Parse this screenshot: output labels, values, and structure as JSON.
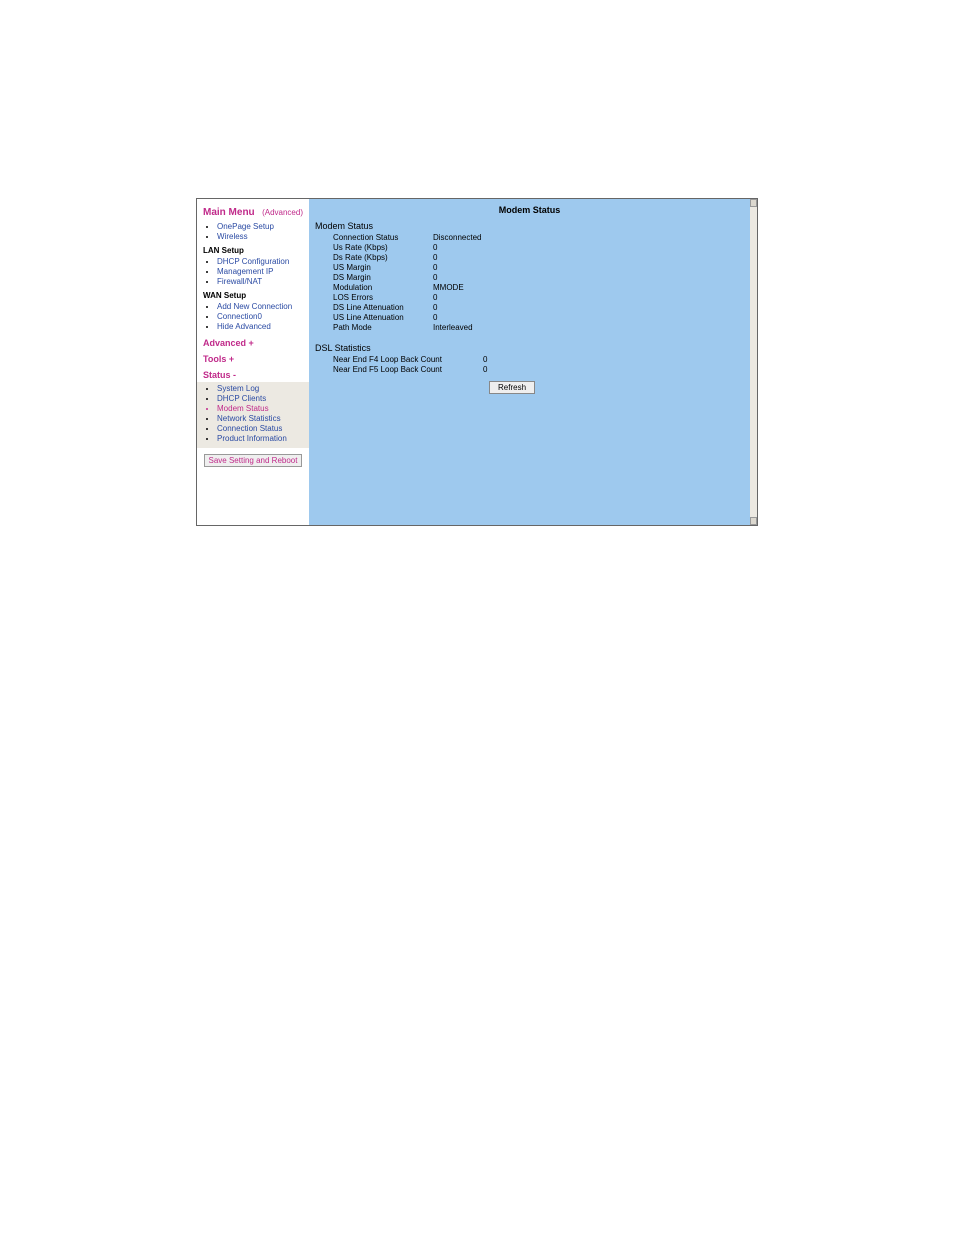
{
  "sidebar": {
    "main_menu_label": "Main Menu",
    "advanced_label": "(Advanced)",
    "nav": {
      "onepage": "OnePage Setup",
      "wireless": "Wireless",
      "lan_heading": "LAN Setup",
      "dhcp_config": "DHCP Configuration",
      "mgmt_ip": "Management IP",
      "firewall": "Firewall/NAT",
      "wan_heading": "WAN Setup",
      "add_conn": "Add New Connection",
      "conn0": "Connection0",
      "hide_adv": "Hide Advanced"
    },
    "advanced_section": "Advanced +",
    "tools_section": "Tools +",
    "status_section": "Status -",
    "status": {
      "syslog": "System Log",
      "dhcp_clients": "DHCP Clients",
      "modem_status": "Modem Status",
      "net_stats": "Network Statistics",
      "conn_status": "Connection Status",
      "product_info": "Product Information"
    },
    "save_button": "Save Setting and Reboot"
  },
  "content": {
    "page_title": "Modem Status",
    "modem_status_heading": "Modem Status",
    "modem_status": [
      {
        "label": "Connection Status",
        "value": "Disconnected"
      },
      {
        "label": "Us Rate (Kbps)",
        "value": "0"
      },
      {
        "label": "Ds Rate (Kbps)",
        "value": "0"
      },
      {
        "label": "US Margin",
        "value": "0"
      },
      {
        "label": "DS Margin",
        "value": "0"
      },
      {
        "label": "Modulation",
        "value": "MMODE"
      },
      {
        "label": "LOS Errors",
        "value": "0"
      },
      {
        "label": "DS Line Attenuation",
        "value": "0"
      },
      {
        "label": "US Line Attenuation",
        "value": "0"
      },
      {
        "label": "Path Mode",
        "value": "Interleaved"
      }
    ],
    "dsl_heading": "DSL Statistics",
    "dsl_stats": [
      {
        "label": "Near End F4 Loop Back Count",
        "value": "0"
      },
      {
        "label": "Near End F5 Loop Back Count",
        "value": "0"
      }
    ],
    "refresh_label": "Refresh"
  }
}
